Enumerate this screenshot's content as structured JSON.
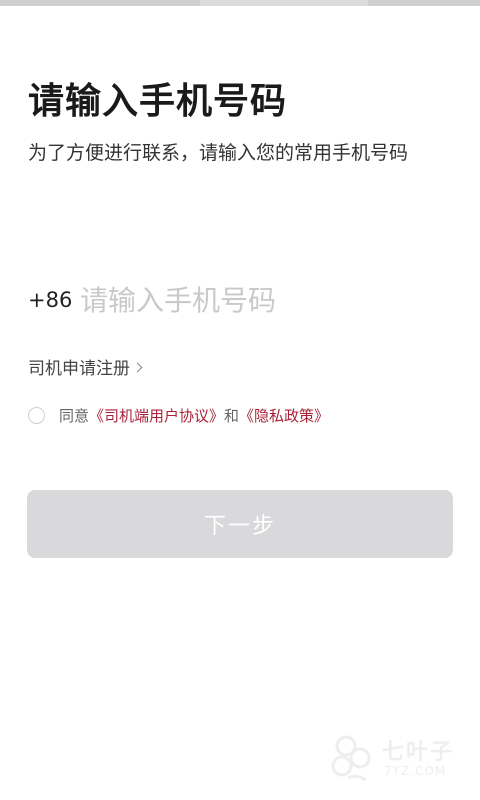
{
  "header": {
    "title": "请输入手机号码",
    "subtitle": "为了方便进行联系，请输入您的常用手机号码"
  },
  "phone": {
    "country_code": "+86",
    "placeholder": "请输入手机号码",
    "value": ""
  },
  "register": {
    "label": "司机申请注册",
    "icon": "chevron-right-icon"
  },
  "agreement": {
    "checked": false,
    "prefix": "同意",
    "user_agreement": "《司机端用户协议》",
    "conjunction": "和",
    "privacy_policy": "《隐私政策》"
  },
  "actions": {
    "next_label": "下一步"
  },
  "watermark": {
    "text": "七叶子",
    "sub": "7YZ.COM",
    "icon": "leaf-logo-icon"
  },
  "colors": {
    "link": "#a8233a",
    "button_disabled": "#d9d9dc",
    "placeholder": "#c9c9c9"
  }
}
